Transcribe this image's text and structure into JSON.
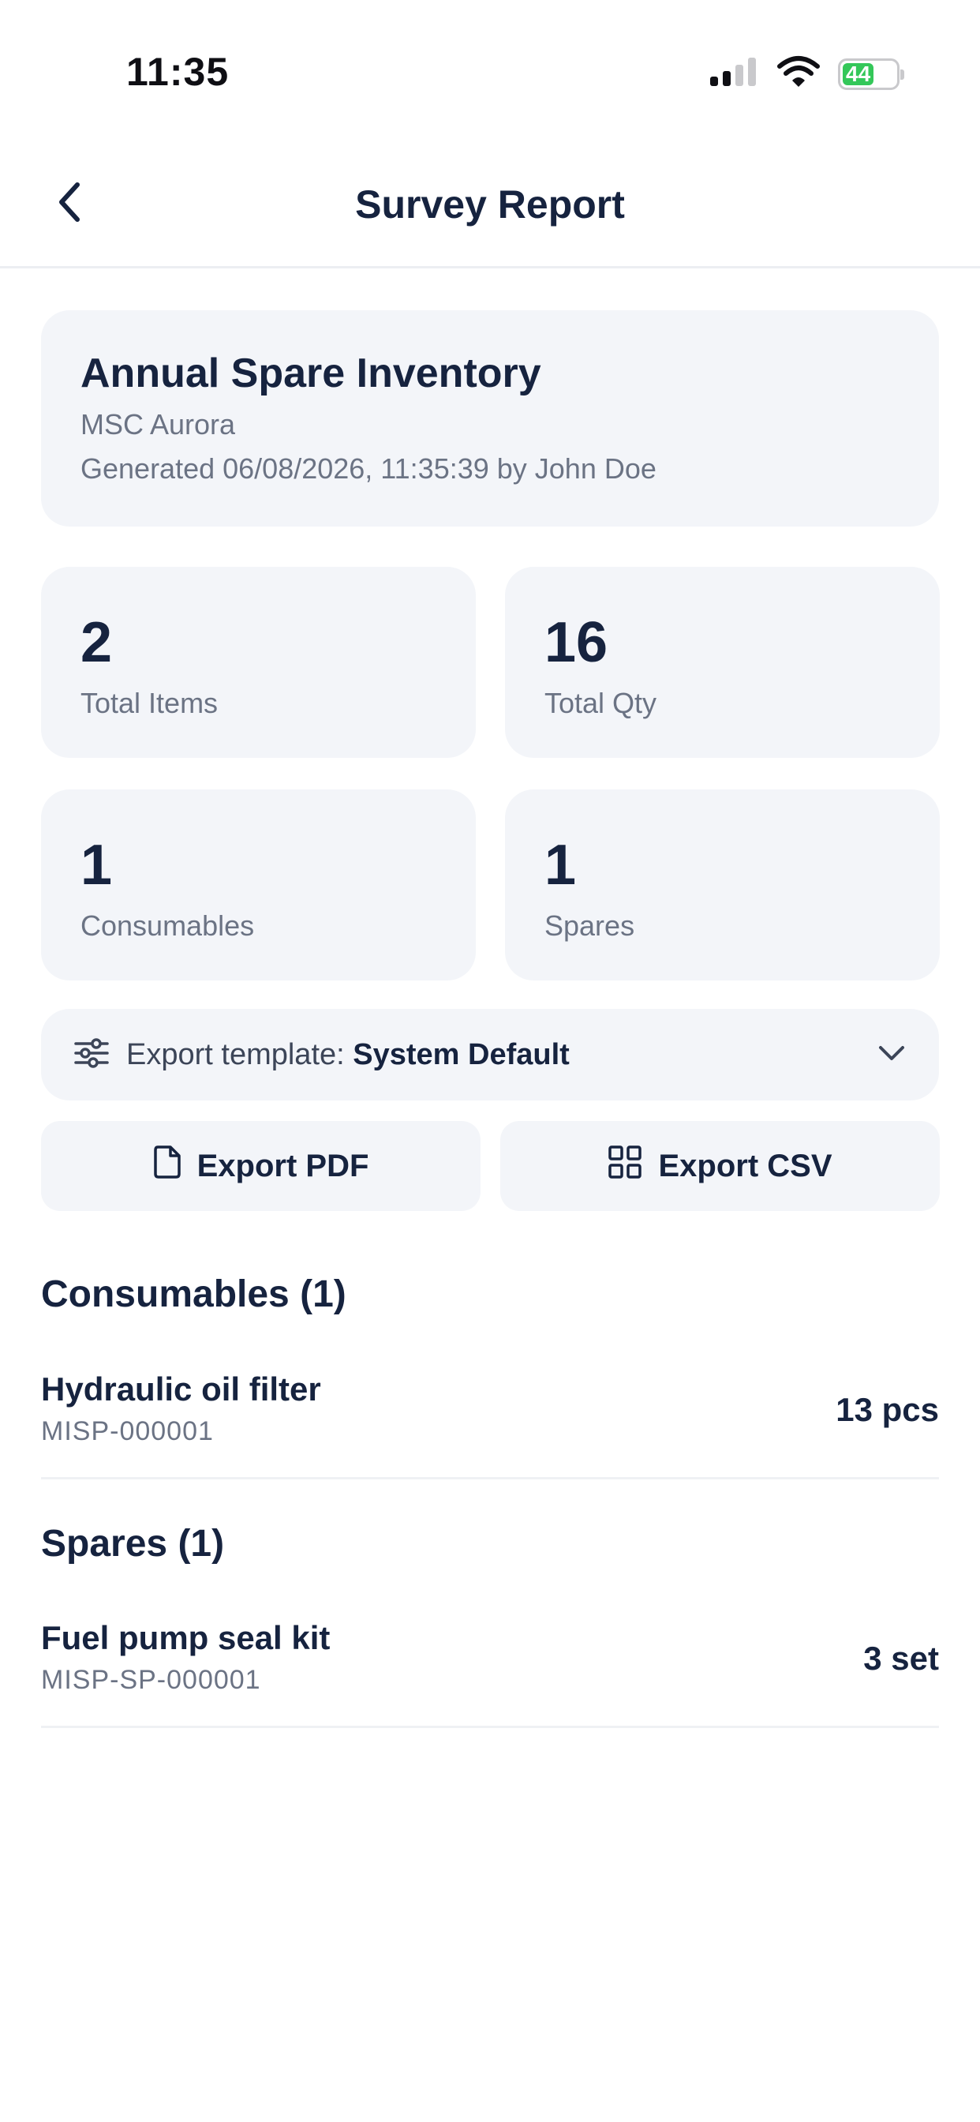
{
  "status_bar": {
    "time": "11:35",
    "battery": "44"
  },
  "nav": {
    "title": "Survey Report"
  },
  "summary": {
    "title": "Annual Spare Inventory",
    "vessel": "MSC Aurora",
    "generated": "Generated 06/08/2026, 11:35:39 by John Doe"
  },
  "stats": [
    {
      "value": "2",
      "label": "Total Items"
    },
    {
      "value": "16",
      "label": "Total Qty"
    },
    {
      "value": "1",
      "label": "Consumables"
    },
    {
      "value": "1",
      "label": "Spares"
    }
  ],
  "export_template": {
    "label": "Export template:",
    "value": "System Default"
  },
  "actions": {
    "export_pdf": "Export PDF",
    "export_csv": "Export CSV"
  },
  "sections": [
    {
      "heading": "Consumables (1)",
      "items": [
        {
          "name": "Hydraulic oil filter",
          "code": "MISP-000001",
          "qty": "13 pcs"
        }
      ]
    },
    {
      "heading": "Spares (1)",
      "items": [
        {
          "name": "Fuel pump seal kit",
          "code": "MISP-SP-000001",
          "qty": "3 set"
        }
      ]
    }
  ]
}
